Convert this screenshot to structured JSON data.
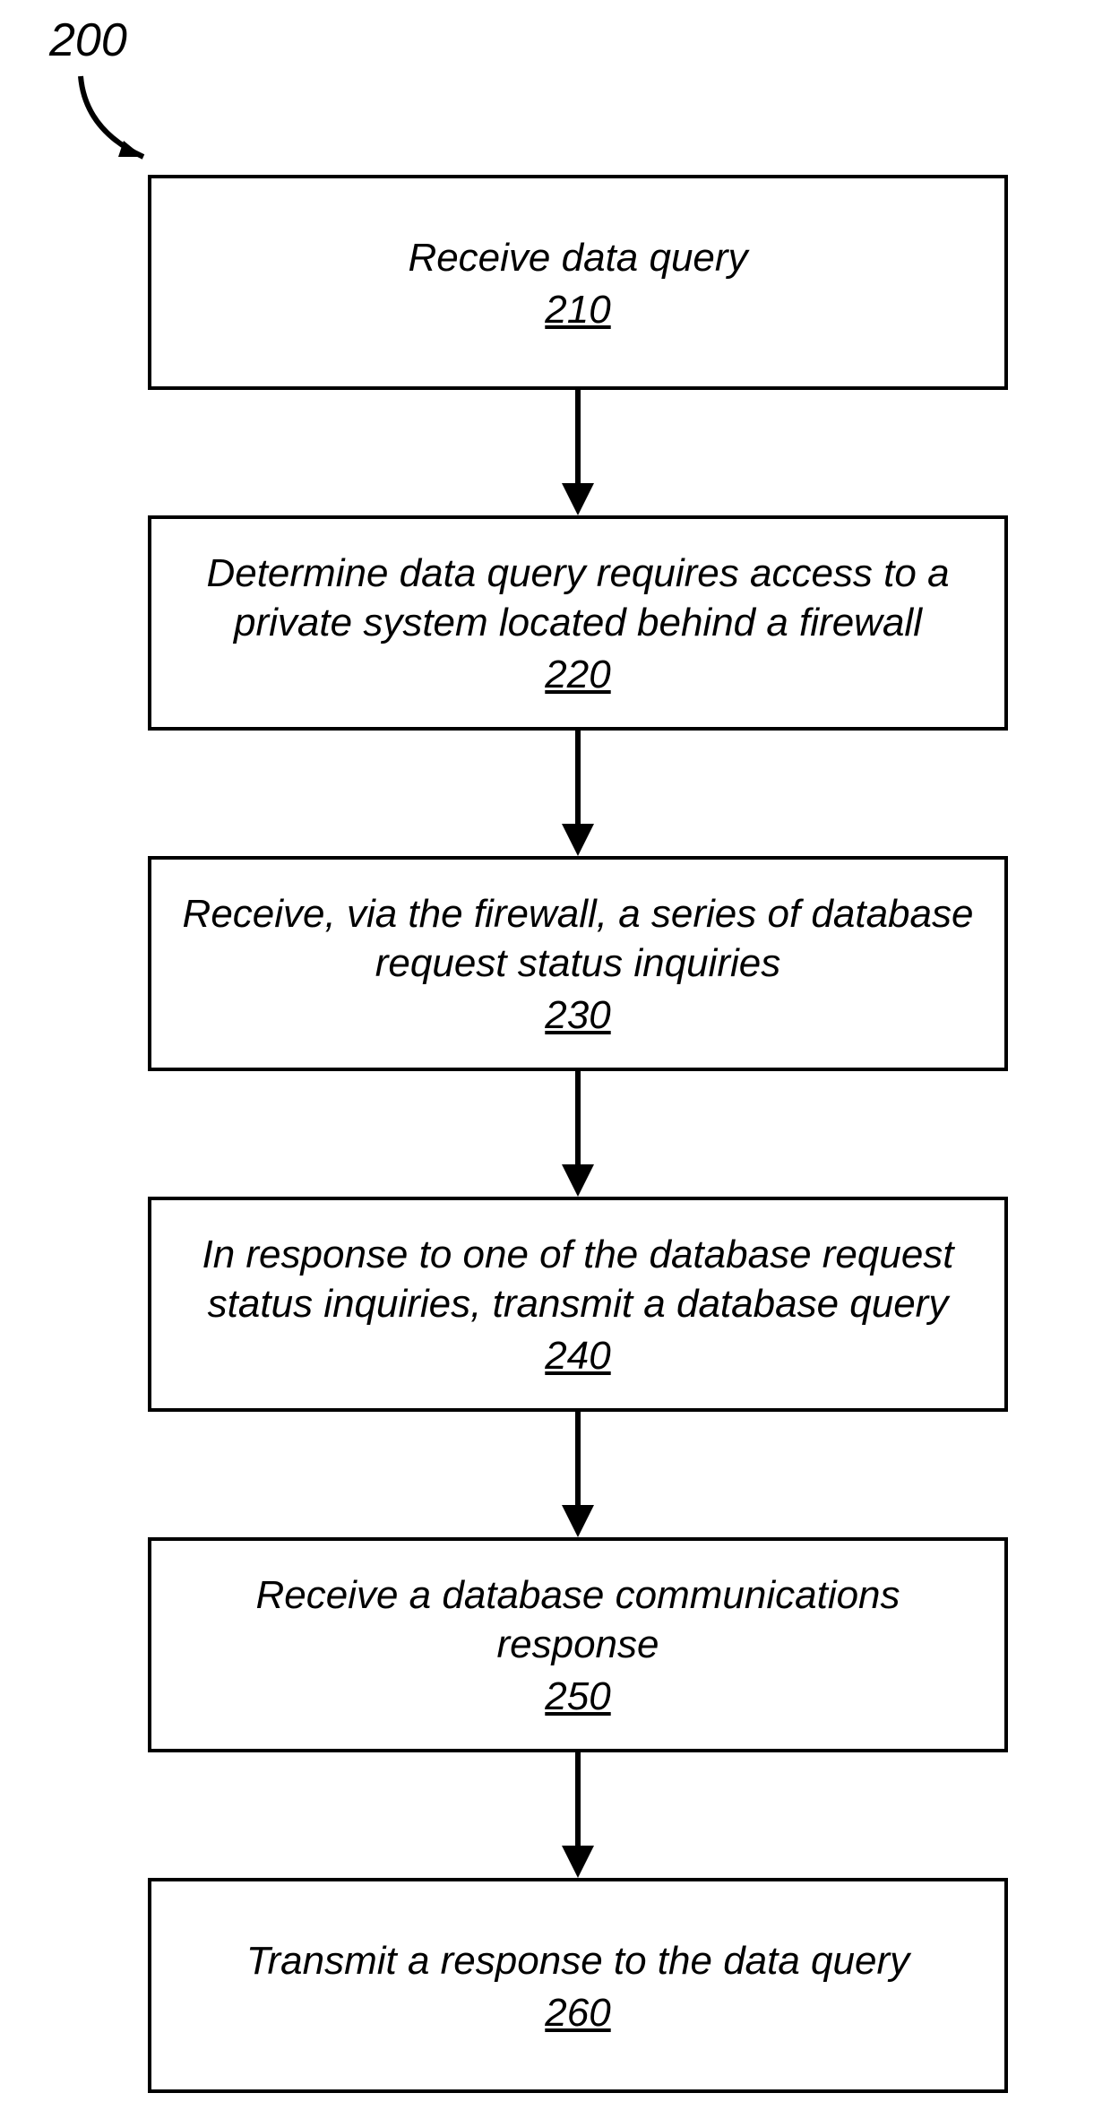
{
  "figure": {
    "label": "200"
  },
  "steps": [
    {
      "text": "Receive data query",
      "ref": "210"
    },
    {
      "text": "Determine data query requires access to a private system located behind a firewall",
      "ref": "220"
    },
    {
      "text": "Receive, via the firewall, a series of database request status inquiries",
      "ref": "230"
    },
    {
      "text": "In response to one of the database request status inquiries, transmit a database query",
      "ref": "240"
    },
    {
      "text": "Receive a database communications response",
      "ref": "250"
    },
    {
      "text": "Transmit a response to the data query",
      "ref": "260"
    }
  ]
}
